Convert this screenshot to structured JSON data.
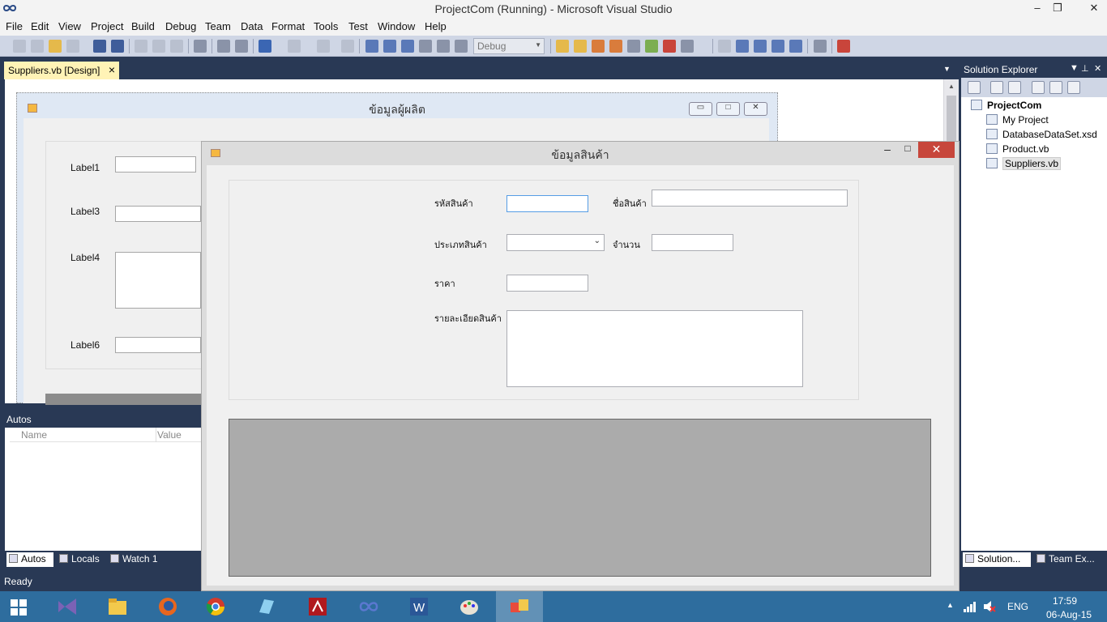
{
  "window": {
    "title": "ProjectCom (Running) - Microsoft Visual Studio"
  },
  "menu": [
    "File",
    "Edit",
    "View",
    "Project",
    "Build",
    "Debug",
    "Team",
    "Data",
    "Format",
    "Tools",
    "Test",
    "Window",
    "Help"
  ],
  "toolbar": {
    "config": "Debug"
  },
  "doc_tab": {
    "label": "Suppliers.vb [Design]"
  },
  "suppliers_form": {
    "title": "ข้อมูลผู้ผลิต",
    "labels": [
      "Label1",
      "Label3",
      "Label4",
      "Label6"
    ]
  },
  "autos": {
    "title": "Autos",
    "col_name": "Name",
    "col_value": "Value"
  },
  "bottom_tabs": [
    "Autos",
    "Locals",
    "Watch 1"
  ],
  "status": "Ready",
  "product_form": {
    "title": "ข้อมูลสินค้า",
    "lbl_code": "รหัสสินค้า",
    "lbl_name": "ชื่อสินค้า",
    "lbl_type": "ประเภทสินค้า",
    "lbl_qty": "จำนวน",
    "lbl_price": "ราคา",
    "lbl_detail": "รายละเอียดสินค้า"
  },
  "solution_explorer": {
    "title": "Solution Explorer",
    "project": "ProjectCom",
    "items": [
      "My Project",
      "DatabaseDataSet.xsd",
      "Product.vb",
      "Suppliers.vb"
    ],
    "tabs": [
      "Solution...",
      "Team Ex..."
    ]
  },
  "tray": {
    "lang": "ENG",
    "time": "17:59",
    "date": "06-Aug-15"
  }
}
